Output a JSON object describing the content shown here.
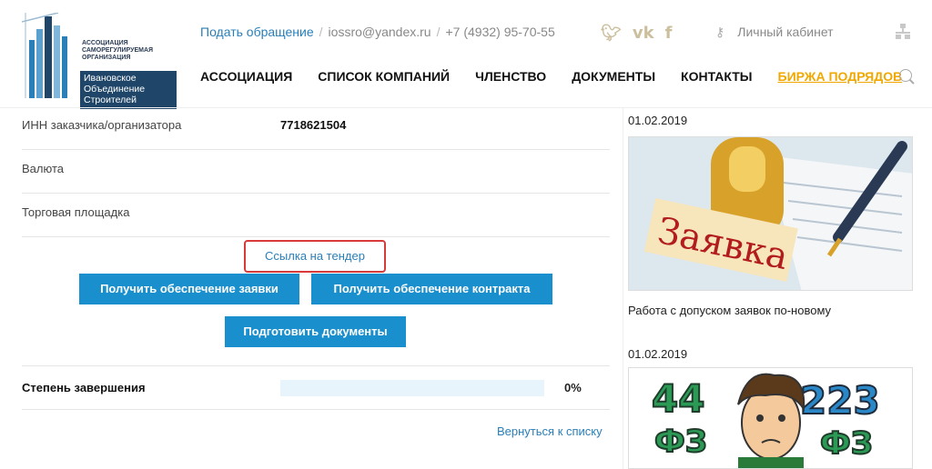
{
  "header": {
    "logo_lines": [
      "Ассоциация",
      "саморегулируемая",
      "организация"
    ],
    "logo_box_lines": [
      "Ивановское",
      "Объединение",
      "Строителей"
    ],
    "appeal_link": "Подать обращение",
    "email": "iossro@yandex.ru",
    "phone": "+7 (4932) 95-70-55",
    "social_icons": [
      "twitter-icon",
      "vk-icon",
      "facebook-icon"
    ],
    "cabinet_label": "Личный кабинет",
    "nav": [
      "АССОЦИАЦИЯ",
      "СПИСОК КОМПАНИЙ",
      "ЧЛЕНСТВО",
      "ДОКУМЕНТЫ",
      "КОНТАКТЫ",
      "БИРЖА ПОДРЯДОВ"
    ]
  },
  "fields": [
    {
      "label": "ИНН заказчика/организатора",
      "value": "7718621504"
    },
    {
      "label": "Валюта",
      "value": ""
    },
    {
      "label": "Торговая площадка",
      "value": ""
    }
  ],
  "tender_link": "Ссылка на тендер",
  "buttons": {
    "get_application_security": "Получить обеспечение заявки",
    "get_contract_security": "Получить обеспечение контракта",
    "prepare_documents": "Подготовить документы"
  },
  "progress": {
    "label": "Степень завершения",
    "value_text": "0%",
    "fraction": 0
  },
  "back_link": "Вернуться к списку",
  "news": [
    {
      "date": "01.02.2019",
      "title": "Работа с допуском заявок по-новому",
      "image_text": "Заявка"
    },
    {
      "date": "01.02.2019",
      "title": "",
      "image_text_left": "44",
      "image_text_right": "223",
      "image_sub": "ФЗ"
    }
  ],
  "colors": {
    "accent": "#1a8fce",
    "link": "#2a7fb8",
    "exchange": "#f0a800",
    "highlight": "#d83a3a"
  }
}
